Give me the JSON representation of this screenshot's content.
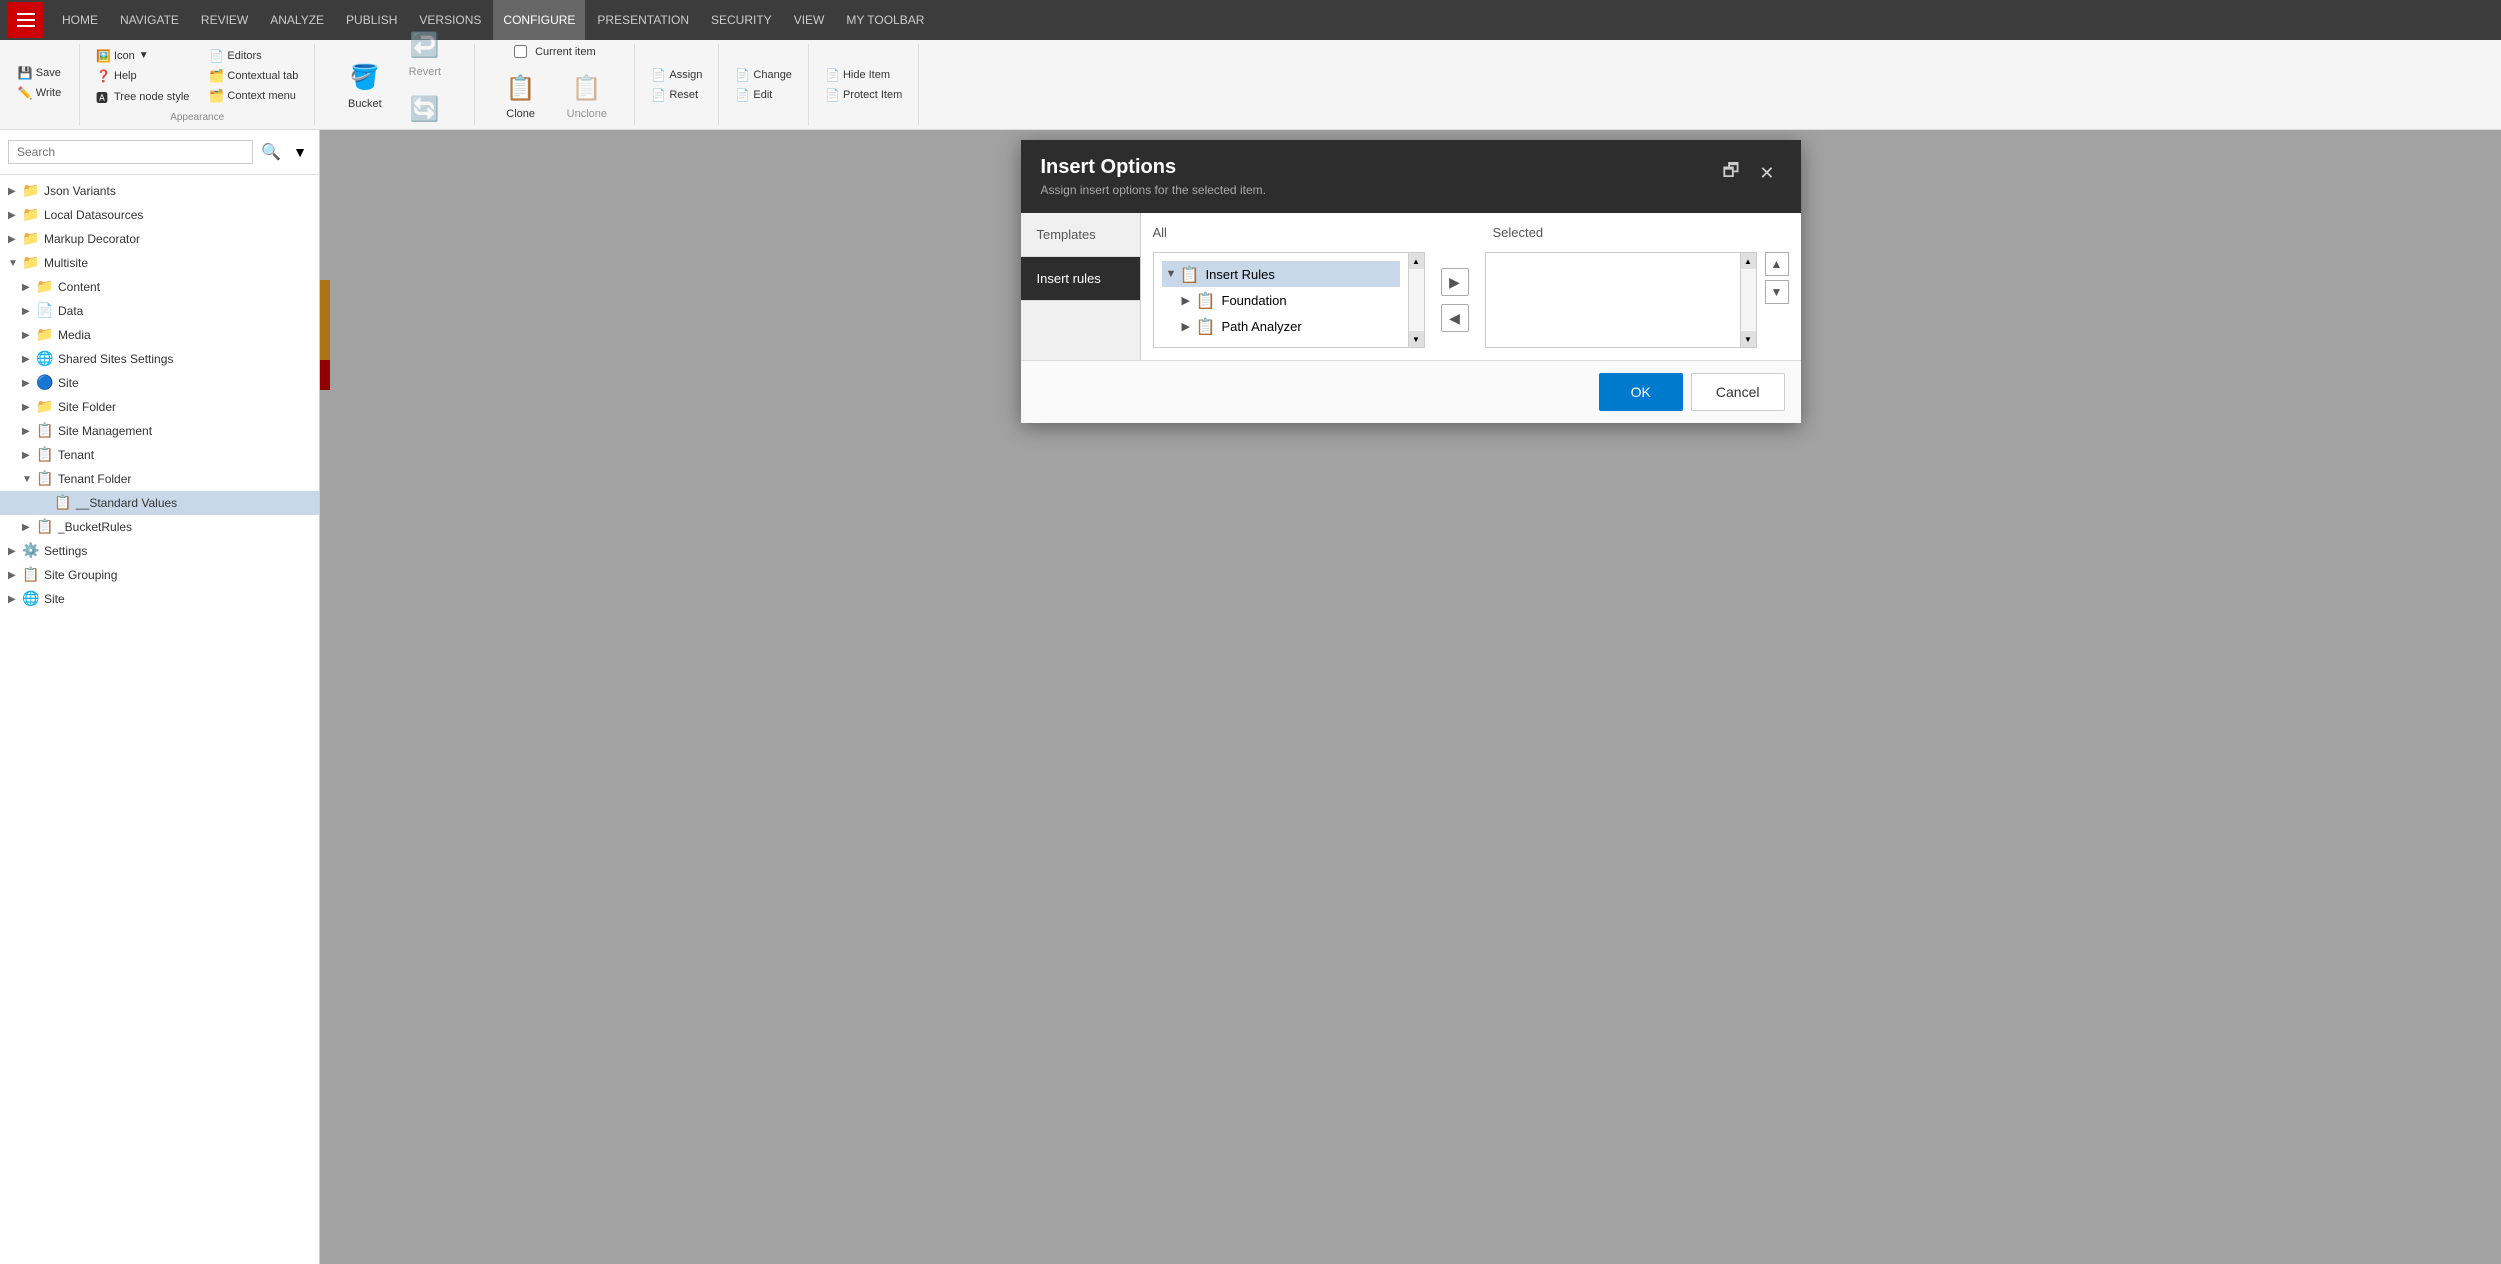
{
  "nav": {
    "items": [
      "HOME",
      "NAVIGATE",
      "REVIEW",
      "ANALYZE",
      "PUBLISH",
      "VERSIONS",
      "CONFIGURE",
      "PRESENTATION",
      "SECURITY",
      "VIEW",
      "MY TOOLBAR"
    ],
    "active": "CONFIGURE"
  },
  "ribbon": {
    "appearance_section": "Appearance",
    "icon_btn": "Icon",
    "help_btn": "Help",
    "tree_node_style": "Tree node style",
    "editors_btn": "Editors",
    "contextual_tab": "Contextual tab",
    "context_menu": "Context menu",
    "bucket_btn": "Bucket",
    "revert_btn": "Revert",
    "sync_btn": "Sync",
    "current_item_label": "Current item",
    "clone_btn": "Clone",
    "unclone_btn": "Unclone",
    "assign_btn": "Assign",
    "reset_btn": "Reset",
    "change_btn": "Change",
    "edit_btn": "Edit",
    "hide_item_btn": "Hide Item",
    "protect_item_btn": "Protect Item"
  },
  "search": {
    "placeholder": "Search",
    "value": ""
  },
  "tree": {
    "items": [
      {
        "label": "Json Variants",
        "level": 0,
        "expanded": false,
        "icon": "📁",
        "type": "folder"
      },
      {
        "label": "Local Datasources",
        "level": 0,
        "expanded": false,
        "icon": "📁",
        "type": "folder"
      },
      {
        "label": "Markup Decorator",
        "level": 0,
        "expanded": false,
        "icon": "📁",
        "type": "folder"
      },
      {
        "label": "Multisite",
        "level": 0,
        "expanded": true,
        "icon": "📁",
        "type": "folder"
      },
      {
        "label": "Content",
        "level": 1,
        "expanded": false,
        "icon": "📁",
        "type": "folder"
      },
      {
        "label": "Data",
        "level": 1,
        "expanded": false,
        "icon": "📄",
        "type": "data"
      },
      {
        "label": "Media",
        "level": 1,
        "expanded": false,
        "icon": "📁",
        "type": "folder"
      },
      {
        "label": "Shared Sites Settings",
        "level": 1,
        "expanded": false,
        "icon": "🌐",
        "type": "special"
      },
      {
        "label": "Site",
        "level": 1,
        "expanded": false,
        "icon": "🔵",
        "type": "site"
      },
      {
        "label": "Site Folder",
        "level": 1,
        "expanded": false,
        "icon": "📁",
        "type": "folder"
      },
      {
        "label": "Site Management",
        "level": 1,
        "expanded": false,
        "icon": "📋",
        "type": "template"
      },
      {
        "label": "Tenant",
        "level": 1,
        "expanded": false,
        "icon": "📋",
        "type": "template"
      },
      {
        "label": "Tenant Folder",
        "level": 1,
        "expanded": true,
        "icon": "📋",
        "type": "template"
      },
      {
        "label": "__Standard Values",
        "level": 2,
        "expanded": false,
        "icon": "📋",
        "type": "template",
        "selected": true
      },
      {
        "label": "_BucketRules",
        "level": 1,
        "expanded": false,
        "icon": "📋",
        "type": "template"
      },
      {
        "label": "Settings",
        "level": 0,
        "expanded": false,
        "icon": "⚙️",
        "type": "settings"
      },
      {
        "label": "Site Grouping",
        "level": 0,
        "expanded": false,
        "icon": "📋",
        "type": "template"
      },
      {
        "label": "Site",
        "level": 0,
        "expanded": false,
        "icon": "🌐",
        "type": "site"
      }
    ]
  },
  "modal": {
    "title": "Insert Options",
    "subtitle": "Assign insert options for the selected item.",
    "tabs": [
      {
        "label": "Templates",
        "active": false
      },
      {
        "label": "Insert rules",
        "active": true
      }
    ],
    "all_label": "All",
    "selected_label": "Selected",
    "tree_items": [
      {
        "label": "Insert Rules",
        "level": 0,
        "expanded": true,
        "selected": true,
        "icon": "📋"
      },
      {
        "label": "Foundation",
        "level": 1,
        "expanded": false,
        "icon": "📋"
      },
      {
        "label": "Path Analyzer",
        "level": 1,
        "expanded": false,
        "icon": "📋"
      }
    ],
    "ok_label": "OK",
    "cancel_label": "Cancel"
  }
}
